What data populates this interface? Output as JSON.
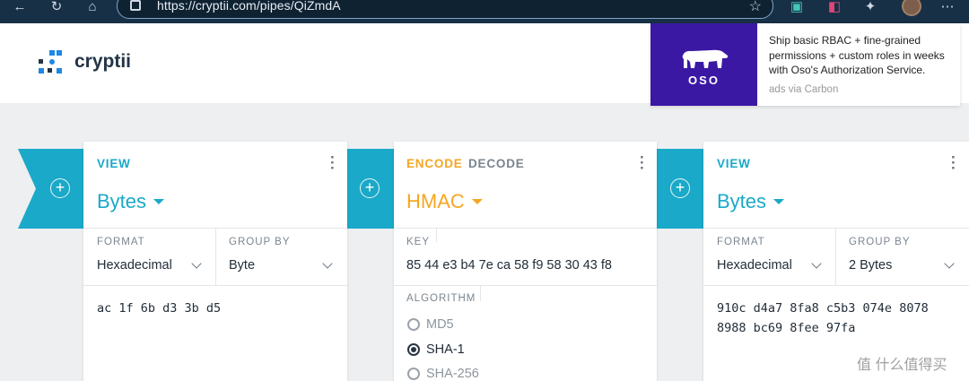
{
  "browser": {
    "url": "https://cryptii.com/pipes/QiZmdA",
    "icons": [
      "back-icon",
      "refresh-icon",
      "home-icon",
      "lock-icon",
      "star-icon",
      "reader-icon",
      "extension-icon",
      "puzzle-icon",
      "profile-avatar",
      "more-icon"
    ]
  },
  "header": {
    "logo_text": "cryptii"
  },
  "ad": {
    "brand": "OSO",
    "text": "Ship basic RBAC + fine-grained permissions + custom roles in weeks with Oso's Authorization Service.",
    "via": "ads via Carbon"
  },
  "bricks": [
    {
      "tab": "VIEW",
      "title": "Bytes",
      "format_label": "FORMAT",
      "format_value": "Hexadecimal",
      "group_label": "GROUP BY",
      "group_value": "Byte",
      "content": "ac 1f 6b d3 3b d5"
    },
    {
      "tab_encode": "ENCODE",
      "tab_decode": "DECODE",
      "title": "HMAC",
      "key_label": "KEY",
      "key_value": "85 44 e3 b4 7e ca 58 f9 58 30 43 f8",
      "algorithm_label": "ALGORITHM",
      "options": [
        "MD5",
        "SHA-1",
        "SHA-256"
      ],
      "selected_option": "SHA-1"
    },
    {
      "tab": "VIEW",
      "title": "Bytes",
      "format_label": "FORMAT",
      "format_value": "Hexadecimal",
      "group_label": "GROUP BY",
      "group_value": "2 Bytes",
      "content_line1": "910c d4a7 8fa8 c5b3 074e 8078",
      "content_line2": "8988 bc69 8fee 97fa"
    }
  ],
  "watermark": "值 什么值得买",
  "colors": {
    "accent": "#1aa9c8",
    "encoder_accent": "#f5a623",
    "ad_bg": "#3a18a4"
  }
}
